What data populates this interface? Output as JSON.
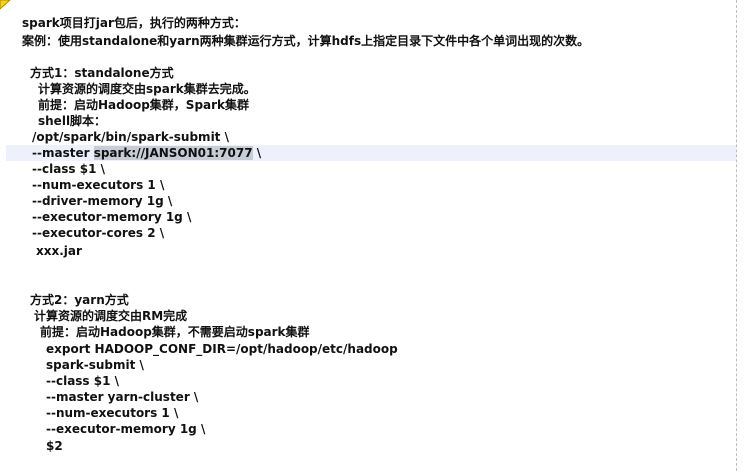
{
  "document": {
    "lines": [
      {
        "text": "spark项目打jar包后，执行的两种方式："
      },
      {
        "text": "案例：使用standalone和yarn两种集群运行方式，计算hdfs上指定目录下文件中各个单词出现的次数。"
      },
      {
        "text": "方式1：standalone方式"
      },
      {
        "text": "计算资源的调度交由spark集群去完成。"
      },
      {
        "text": "前提：启动Hadoop集群，Spark集群"
      },
      {
        "text": "shell脚本："
      },
      {
        "text": "/opt/spark/bin/spark-submit \\"
      },
      {
        "text": "--master ",
        "selected": "spark://JANSON01:7077",
        "after": " \\"
      },
      {
        "text": "--class $1 \\"
      },
      {
        "text": "--num-executors 1 \\"
      },
      {
        "text": "--driver-memory 1g \\"
      },
      {
        "text": "--executor-memory 1g \\"
      },
      {
        "text": "--executor-cores 2 \\"
      },
      {
        "text": "xxx.jar"
      },
      {
        "text": "方式2：yarn方式"
      },
      {
        "text": "计算资源的调度交由RM完成"
      },
      {
        "text": "前提：启动Hadoop集群，不需要启动spark集群"
      },
      {
        "text": "export HADOOP_CONF_DIR=/opt/hadoop/etc/hadoop"
      },
      {
        "text": "spark-submit \\"
      },
      {
        "text": "--class $1 \\"
      },
      {
        "text": "--master yarn-cluster \\"
      },
      {
        "text": "--num-executors 1 \\"
      },
      {
        "text": "--executor-memory 1g \\"
      },
      {
        "text": "$2"
      }
    ]
  }
}
